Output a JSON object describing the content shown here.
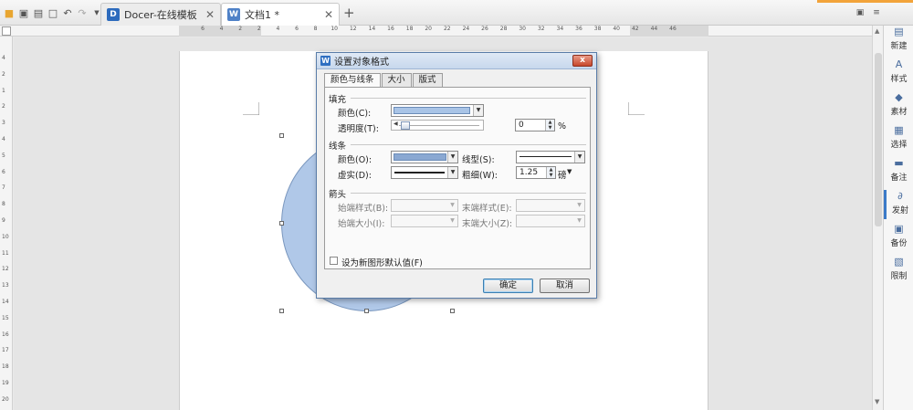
{
  "tabs": [
    {
      "label": "Docer-在线模板",
      "icon": "docer-icon"
    },
    {
      "label": "文档1 *",
      "icon": "document-icon"
    }
  ],
  "ruler": {
    "ticks": [
      "6",
      "4",
      "2",
      "2",
      "4",
      "6",
      "8",
      "10",
      "12",
      "14",
      "16",
      "18",
      "20",
      "22",
      "24",
      "26",
      "28",
      "30",
      "32",
      "34",
      "36",
      "38",
      "40",
      "42",
      "44",
      "46"
    ],
    "vticks": [
      "4",
      "2",
      "1",
      "2",
      "3",
      "4",
      "5",
      "6",
      "7",
      "8",
      "9",
      "10",
      "11",
      "12",
      "13",
      "14",
      "15",
      "16",
      "17",
      "18",
      "19",
      "20",
      "21"
    ]
  },
  "sidebar": {
    "items": [
      {
        "label": "新建",
        "icon": "new-doc-icon"
      },
      {
        "label": "样式",
        "icon": "style-icon"
      },
      {
        "label": "素材",
        "icon": "material-icon"
      },
      {
        "label": "选择",
        "icon": "select-icon"
      },
      {
        "label": "备注",
        "icon": "note-icon"
      },
      {
        "label": "发射",
        "icon": "launch-icon"
      },
      {
        "label": "备份",
        "icon": "backup-icon"
      },
      {
        "label": "限制",
        "icon": "restrict-icon"
      }
    ]
  },
  "dialog": {
    "title": "设置对象格式",
    "close_label": "x",
    "tabs": [
      "颜色与线条",
      "大小",
      "版式"
    ],
    "fill": {
      "section": "填充",
      "color_label": "颜色(C):",
      "transparency_label": "透明度(T):",
      "transparency_value": "0",
      "percent": "%"
    },
    "line": {
      "section": "线条",
      "color_label": "颜色(O):",
      "style_label": "线型(S):",
      "dash_label": "虚实(D):",
      "weight_label": "粗细(W):",
      "weight_value": "1.25",
      "weight_unit": "磅"
    },
    "arrows": {
      "section": "箭头",
      "begin_style_label": "始端样式(B):",
      "end_style_label": "末端样式(E):",
      "begin_size_label": "始端大小(I):",
      "end_size_label": "末端大小(Z):"
    },
    "default_checkbox_label": "设为新图形默认值(F)",
    "ok_label": "确定",
    "cancel_label": "取消"
  },
  "colors": {
    "shape_fill": "#b0c8e8",
    "accent": "#3a7ac8"
  }
}
